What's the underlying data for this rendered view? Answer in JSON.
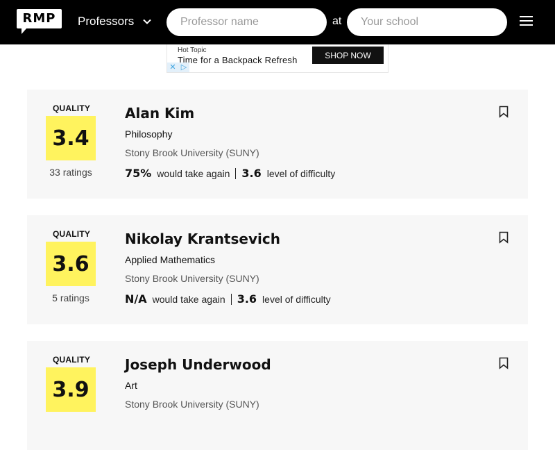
{
  "header": {
    "logo": "RMP",
    "search_type": "Professors",
    "professor_placeholder": "Professor name",
    "at_label": "at",
    "school_placeholder": "Your school"
  },
  "ad": {
    "brand": "Hot Topic",
    "headline": "Time for a Backpack Refresh",
    "button": "SHOP NOW"
  },
  "professors": [
    {
      "quality_label": "QUALITY",
      "quality": "3.4",
      "ratings": "33 ratings",
      "name": "Alan Kim",
      "department": "Philosophy",
      "school": "Stony Brook University (SUNY)",
      "take_again": "75%",
      "take_again_label": "would take again",
      "difficulty": "3.6",
      "difficulty_label": "level of difficulty"
    },
    {
      "quality_label": "QUALITY",
      "quality": "3.6",
      "ratings": "5 ratings",
      "name": "Nikolay Krantsevich",
      "department": "Applied Mathematics",
      "school": "Stony Brook University (SUNY)",
      "take_again": "N/A",
      "take_again_label": "would take again",
      "difficulty": "3.6",
      "difficulty_label": "level of difficulty"
    },
    {
      "quality_label": "QUALITY",
      "quality": "3.9",
      "name": "Joseph Underwood",
      "department": "Art",
      "school": "Stony Brook University (SUNY)"
    }
  ]
}
